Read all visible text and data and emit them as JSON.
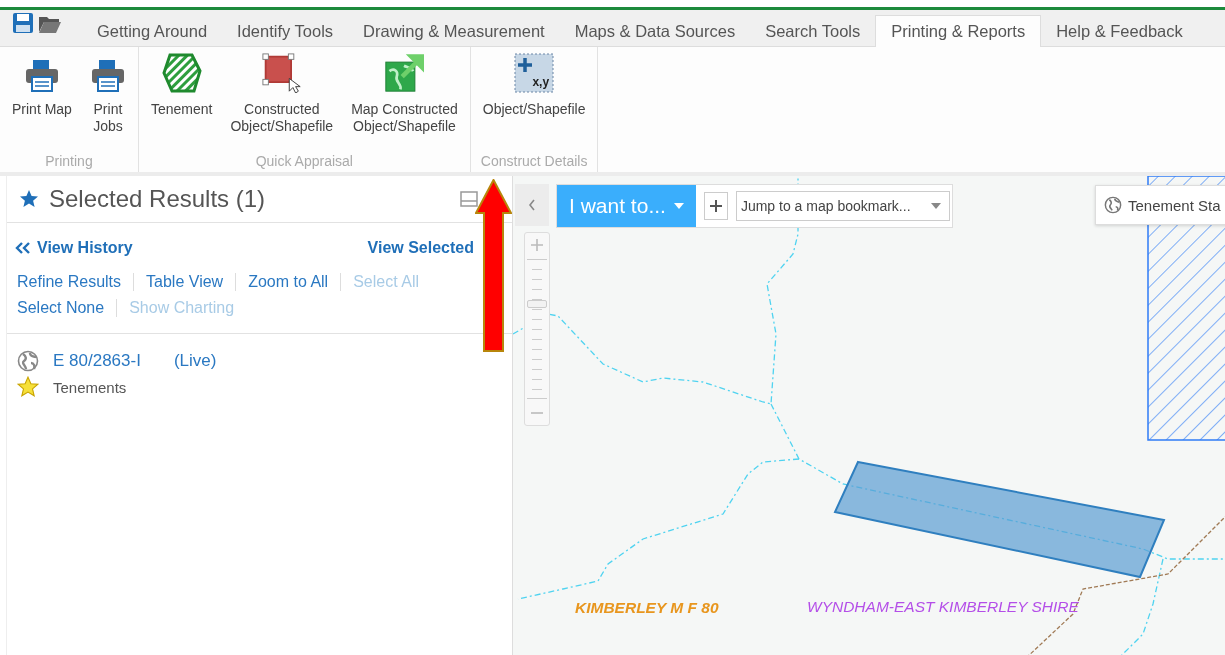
{
  "tabs": [
    {
      "label": "Getting Around",
      "selected": false
    },
    {
      "label": "Identify Tools",
      "selected": false
    },
    {
      "label": "Drawing & Measurement",
      "selected": false
    },
    {
      "label": "Maps & Data Sources",
      "selected": false
    },
    {
      "label": "Search Tools",
      "selected": false
    },
    {
      "label": "Printing & Reports",
      "selected": true
    },
    {
      "label": "Help & Feedback",
      "selected": false
    }
  ],
  "ribbon_groups": [
    {
      "label": "Printing",
      "buttons": [
        {
          "label": "Print Map",
          "kind": "printer"
        },
        {
          "label": "Print\nJobs",
          "kind": "printer"
        }
      ]
    },
    {
      "label": "Quick Appraisal",
      "buttons": [
        {
          "label": "Tenement",
          "kind": "tenement"
        },
        {
          "label": "Constructed\nObject/Shapefile",
          "kind": "constructed"
        },
        {
          "label": "Map Constructed\nObject/Shapefile",
          "kind": "map-constructed"
        }
      ]
    },
    {
      "label": "Construct Details",
      "buttons": [
        {
          "label": "Object/Shapefile",
          "kind": "xy",
          "icon_text": "x,y"
        }
      ]
    }
  ],
  "panel": {
    "title": "Selected Results (1)",
    "view_history": "View History",
    "view_selected": "View Selected",
    "actions": [
      {
        "label": "Refine Results",
        "disabled": false
      },
      {
        "label": "Table View",
        "disabled": false
      },
      {
        "label": "Zoom to All",
        "disabled": false
      },
      {
        "label": "Select All",
        "disabled": true
      },
      {
        "label": "Select None",
        "disabled": false
      },
      {
        "label": "Show Charting",
        "disabled": true
      }
    ],
    "results": [
      {
        "title": "E 80/2863-I",
        "status": "(Live)",
        "layer": "Tenements"
      }
    ]
  },
  "map": {
    "i_want_to": "I want to...",
    "bookmark_placeholder": "Jump to a map bookmark...",
    "tenement_status": "Tenement Sta",
    "zoom": {
      "level": 0.68
    },
    "labels": [
      {
        "text": "KIMBERLEY M F 80",
        "color": "#e8961e"
      },
      {
        "text": "WYNDHAM-EAST KIMBERLEY SHIRE",
        "color": "#b44ee8"
      }
    ]
  }
}
